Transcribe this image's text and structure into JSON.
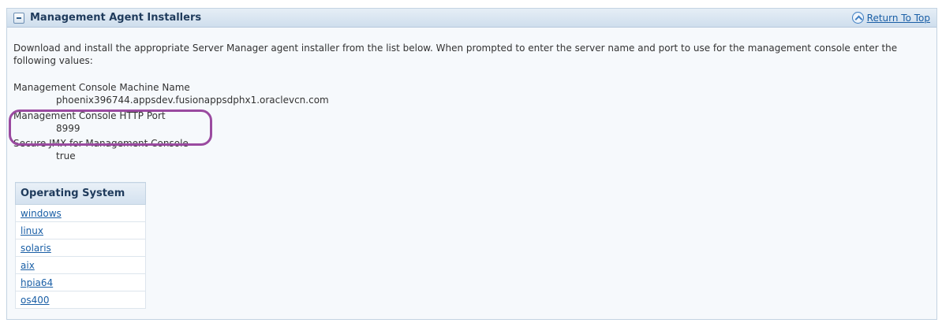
{
  "section": {
    "title": "Management Agent Installers",
    "return_to_top": "Return To Top"
  },
  "intro_text": "Download and install the appropriate Server Manager agent installer from the list below. When prompted to enter the server name and port to use for the management console enter the following values:",
  "fields": {
    "machine_name_label": "Management Console Machine Name",
    "machine_name_value": "phoenix396744.appsdev.fusionappsdphx1.oraclevcn.com",
    "http_port_label": "Management Console HTTP Port",
    "http_port_value": "8999",
    "secure_jmx_label": "Secure JMX for Management Console",
    "secure_jmx_value": "true"
  },
  "os_table": {
    "header": "Operating System",
    "rows": [
      "windows",
      "linux",
      "solaris",
      "aix",
      "hpia64",
      "os400"
    ]
  },
  "colors": {
    "highlight": "#9a4aa0",
    "link": "#1a5fa6",
    "header_text": "#1f3b5c"
  }
}
